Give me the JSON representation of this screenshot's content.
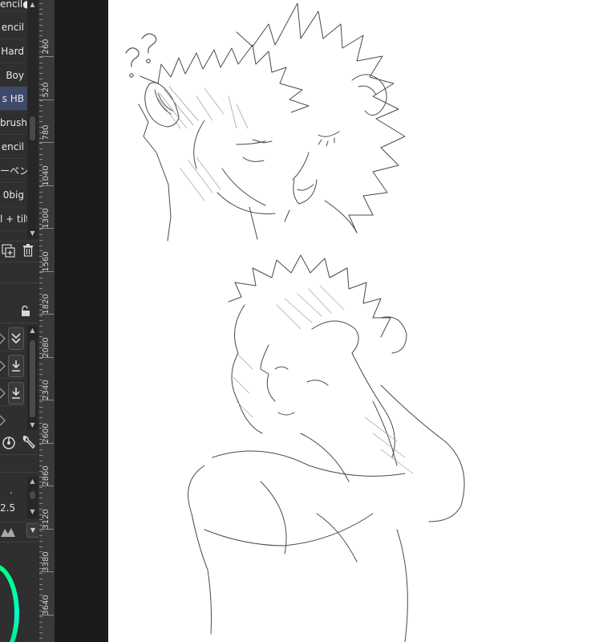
{
  "brush_list": {
    "items": [
      {
        "label": "encil●",
        "selected": false
      },
      {
        "label": "encil",
        "selected": false
      },
      {
        "label": "Hard",
        "selected": false
      },
      {
        "label": "Boy",
        "selected": false
      },
      {
        "label": "s HB",
        "selected": true
      },
      {
        "label": "brush",
        "selected": false
      },
      {
        "label": "encil",
        "selected": false
      },
      {
        "label": "ーペン",
        "selected": false
      },
      {
        "label": "0big",
        "selected": false
      },
      {
        "label": "l + tilt",
        "selected": false
      }
    ]
  },
  "tool_property": {
    "dot_label": ".",
    "value": "2.5"
  },
  "ruler": {
    "labels": [
      "260",
      "520",
      "780",
      "1040",
      "1300",
      "1560",
      "1820",
      "2080",
      "2340",
      "2600",
      "2860",
      "3120",
      "3380",
      "3640"
    ]
  },
  "canvas": {
    "annotation": "??"
  },
  "icons": {
    "scroll_up": "triangle-up",
    "scroll_down": "triangle-down",
    "duplicate": "duplicate-icon",
    "delete": "trash-icon",
    "lock": "lock-icon",
    "merge": "double-chevron-down-icon",
    "download": "download-icon",
    "dial": "dial-icon",
    "wrench": "wrench-icon",
    "brush_shape": "brush-shape-icon",
    "color_ring": "color-wheel-icon"
  },
  "colors": {
    "panel_bg": "#2f2f2f",
    "selected_item": "#3e4a6a",
    "canvas_bg": "#ffffff",
    "color_wheel": "#00ff7a"
  }
}
